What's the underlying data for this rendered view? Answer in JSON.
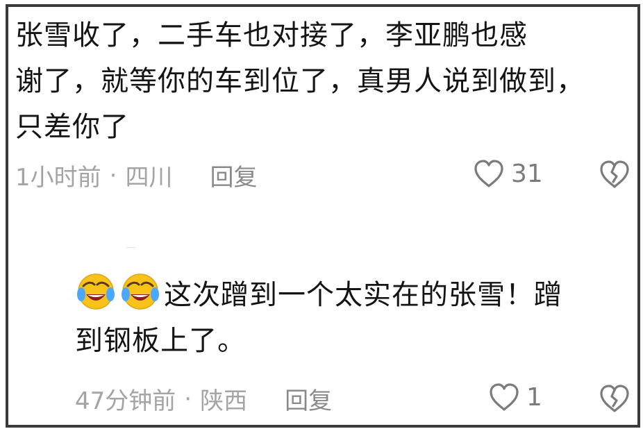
{
  "comment1": {
    "lines": [
      "张雪收了，二手车也对接了，李亚鹏也感",
      "谢了，就等你的车到位了，真男人说到做到，",
      "只差你了"
    ],
    "time": "1小时前",
    "location": "四川",
    "reply_label": "回复",
    "like_count": "31"
  },
  "comment2": {
    "emojis": [
      "crying-laughing-face-icon",
      "crying-laughing-face-icon"
    ],
    "line1": "这次蹭到一个太实在的张雪！蹭",
    "line2": "到钢板上了。",
    "time": "47分钟前",
    "location": "陕西",
    "reply_label": "回复",
    "like_count": "1"
  },
  "separator": "·",
  "colors": {
    "text": "#141414",
    "meta": "#a4a4a4",
    "border": "#3a3a3a",
    "emoji": "#f7c21a"
  }
}
